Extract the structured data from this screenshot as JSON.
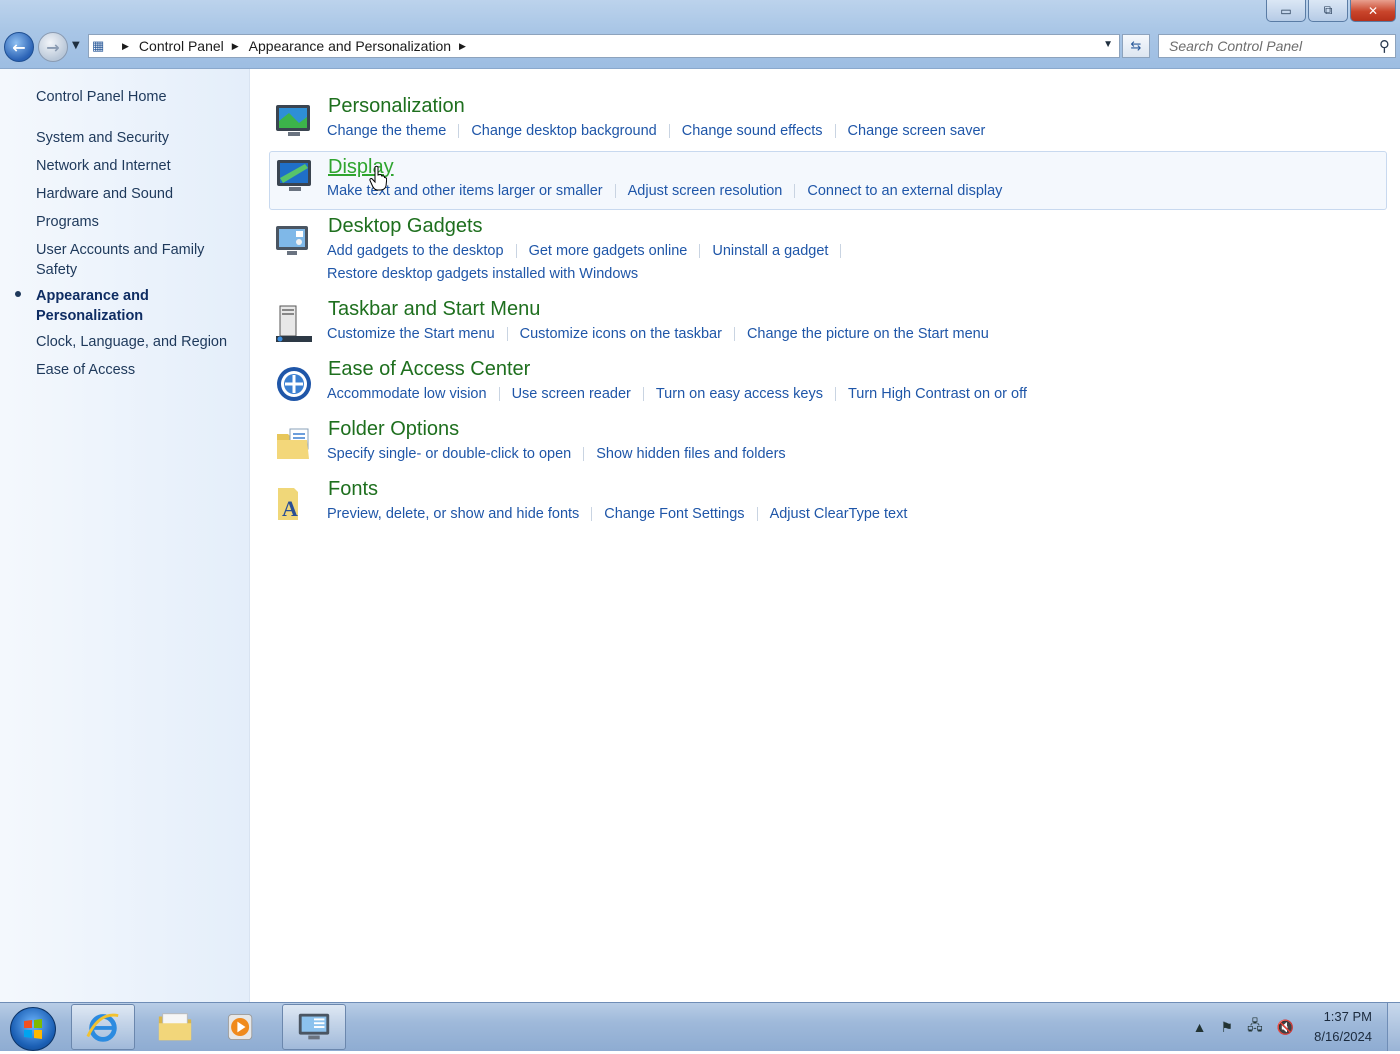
{
  "window": {
    "minimize": "▭",
    "maximize": "⧉",
    "close": "✕"
  },
  "address": {
    "breadcrumbs": [
      "Control Panel",
      "Appearance and Personalization"
    ],
    "search_placeholder": "Search Control Panel"
  },
  "sidebar": {
    "home": "Control Panel Home",
    "items": [
      "System and Security",
      "Network and Internet",
      "Hardware and Sound",
      "Programs",
      "User Accounts and Family Safety",
      "Appearance and Personalization",
      "Clock, Language, and Region",
      "Ease of Access"
    ],
    "active_index": 5
  },
  "categories": [
    {
      "title": "Personalization",
      "icon": "personalization-icon",
      "links": [
        "Change the theme",
        "Change desktop background",
        "Change sound effects",
        "Change screen saver"
      ]
    },
    {
      "title": "Display",
      "icon": "display-icon",
      "links": [
        "Make text and other items larger or smaller",
        "Adjust screen resolution",
        "Connect to an external display"
      ]
    },
    {
      "title": "Desktop Gadgets",
      "icon": "gadgets-icon",
      "links": [
        "Add gadgets to the desktop",
        "Get more gadgets online",
        "Uninstall a gadget",
        "Restore desktop gadgets installed with Windows"
      ]
    },
    {
      "title": "Taskbar and Start Menu",
      "icon": "taskbar-icon",
      "links": [
        "Customize the Start menu",
        "Customize icons on the taskbar",
        "Change the picture on the Start menu"
      ]
    },
    {
      "title": "Ease of Access Center",
      "icon": "ease-of-access-icon",
      "links": [
        "Accommodate low vision",
        "Use screen reader",
        "Turn on easy access keys",
        "Turn High Contrast on or off"
      ]
    },
    {
      "title": "Folder Options",
      "icon": "folder-options-icon",
      "links": [
        "Specify single- or double-click to open",
        "Show hidden files and folders"
      ]
    },
    {
      "title": "Fonts",
      "icon": "fonts-icon",
      "links": [
        "Preview, delete, or show and hide fonts",
        "Change Font Settings",
        "Adjust ClearType text"
      ]
    }
  ],
  "taskbar": {
    "time": "1:37 PM",
    "date": "8/16/2024"
  },
  "colors": {
    "category_title": "#1e6f1e",
    "link": "#1f56a8",
    "hovered_title": "#2fa52f"
  }
}
